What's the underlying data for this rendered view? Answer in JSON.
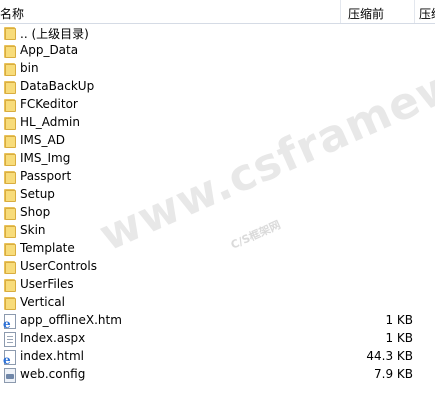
{
  "header": {
    "name_label": "名称",
    "size_label": "压缩前",
    "ratio_label": "压缩"
  },
  "items": [
    {
      "name": ".. (上级目录)",
      "type": "folder",
      "size": ""
    },
    {
      "name": "App_Data",
      "type": "folder",
      "size": ""
    },
    {
      "name": "bin",
      "type": "folder",
      "size": ""
    },
    {
      "name": "DataBackUp",
      "type": "folder",
      "size": ""
    },
    {
      "name": "FCKeditor",
      "type": "folder",
      "size": ""
    },
    {
      "name": "HL_Admin",
      "type": "folder",
      "size": ""
    },
    {
      "name": "IMS_AD",
      "type": "folder",
      "size": ""
    },
    {
      "name": "IMS_Img",
      "type": "folder",
      "size": ""
    },
    {
      "name": "Passport",
      "type": "folder",
      "size": ""
    },
    {
      "name": "Setup",
      "type": "folder",
      "size": ""
    },
    {
      "name": "Shop",
      "type": "folder",
      "size": ""
    },
    {
      "name": "Skin",
      "type": "folder",
      "size": ""
    },
    {
      "name": "Template",
      "type": "folder",
      "size": ""
    },
    {
      "name": "UserControls",
      "type": "folder",
      "size": ""
    },
    {
      "name": "UserFiles",
      "type": "folder",
      "size": ""
    },
    {
      "name": "Vertical",
      "type": "folder",
      "size": ""
    },
    {
      "name": "app_offlineX.htm",
      "type": "ie-document-icon",
      "size": "1 KB"
    },
    {
      "name": "Index.aspx",
      "type": "text-document-icon",
      "size": "1 KB"
    },
    {
      "name": "index.html",
      "type": "ie-document-icon",
      "size": "44.3 KB"
    },
    {
      "name": "web.config",
      "type": "config-document-icon",
      "size": "7.9 KB"
    }
  ],
  "watermark": {
    "text": "www.csframework.com",
    "subtext": "C/S框架网"
  }
}
